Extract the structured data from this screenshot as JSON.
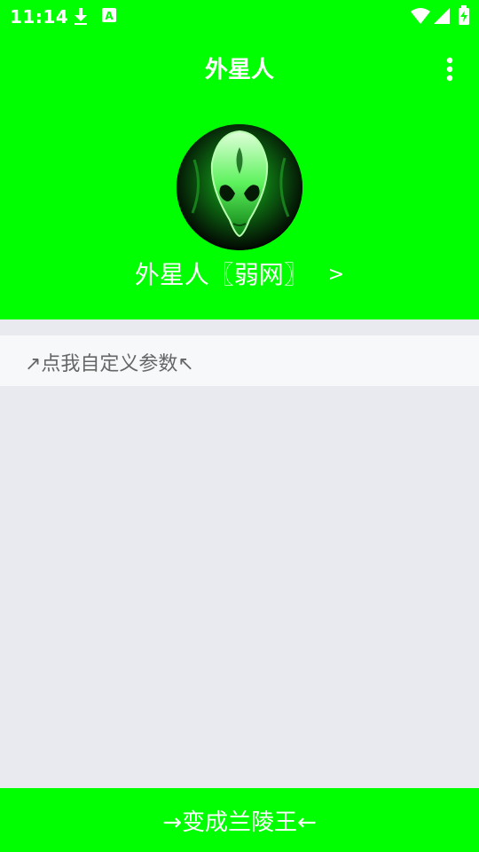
{
  "status_bar": {
    "time": "11:14",
    "icons": [
      "download-icon",
      "font-a-icon",
      "wifi-icon",
      "cellular-signal-icon",
      "battery-charging-icon"
    ]
  },
  "toolbar": {
    "title": "外星人",
    "menu_icon": "more-vert-icon"
  },
  "profile": {
    "avatar": "alien-head-avatar",
    "name": "外星人〖弱网〗",
    "chevron": ">"
  },
  "custom_params": {
    "label": "↗点我自定义参数↖"
  },
  "bottom_button": {
    "label": "→变成兰陵王←"
  },
  "colors": {
    "accent": "#00ff00",
    "content_bg": "#e8eaf0",
    "row_bg": "#f7f8fa",
    "row_text": "#666666"
  }
}
